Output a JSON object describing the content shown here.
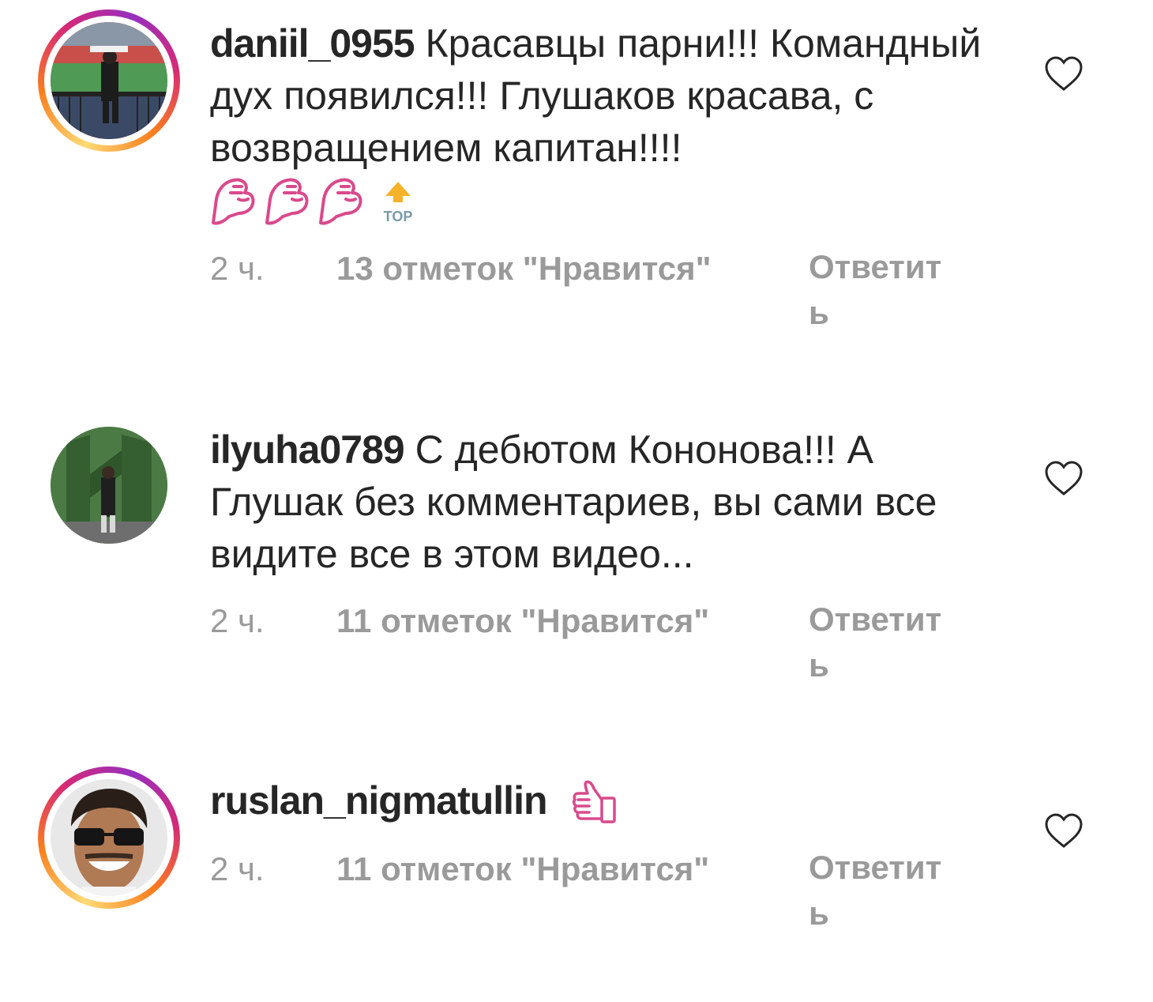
{
  "comments": [
    {
      "username": "daniil_0955",
      "text": "Красавцы парни!!! Командный дух появился!!! Глушаков красава, с возвращением капитан!!!!",
      "time": "2 ч.",
      "likes": "13 отметок \"Нравится\"",
      "reply": "Ответить",
      "has_story_ring": true,
      "emoji": [
        "flexed-biceps-icon",
        "flexed-biceps-icon",
        "flexed-biceps-icon",
        "top-arrow-icon"
      ],
      "top_label": "TOP"
    },
    {
      "username": "ilyuha0789",
      "text": "С дебютом Кононова!!! А Глушак без комментариев, вы сами все видите все в этом видео...",
      "time": "2 ч.",
      "likes": "11 отметок \"Нравится\"",
      "reply": "Ответить",
      "has_story_ring": false
    },
    {
      "username": "ruslan_nigmatullin",
      "text": "",
      "time": "2 ч.",
      "likes": "11 отметок \"Нравится\"",
      "reply": "Ответить",
      "has_story_ring": true,
      "emoji": [
        "thumbs-up-icon"
      ]
    }
  ],
  "colors": {
    "text": "#262626",
    "meta": "#9a9a9a",
    "emoji_outline": "#d94a8c",
    "top_arrow": "#f5b32a"
  }
}
